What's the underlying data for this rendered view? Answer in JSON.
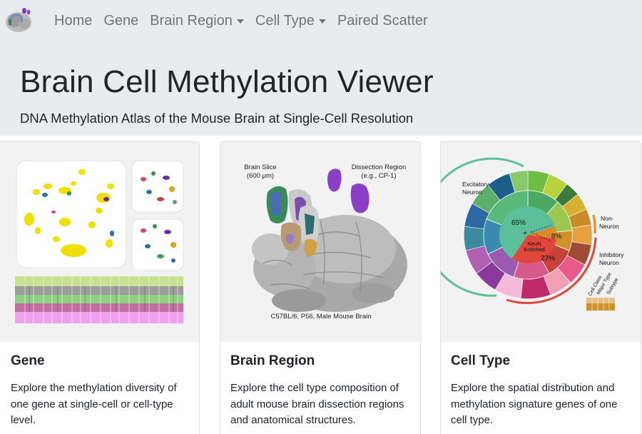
{
  "nav": {
    "items": [
      {
        "label": "Home",
        "dropdown": false
      },
      {
        "label": "Gene",
        "dropdown": false
      },
      {
        "label": "Brain Region",
        "dropdown": true
      },
      {
        "label": "Cell Type",
        "dropdown": true
      },
      {
        "label": "Paired Scatter",
        "dropdown": false
      }
    ]
  },
  "hero": {
    "title": "Brain Cell Methylation Viewer",
    "subtitle": "DNA Methylation Atlas of the Mouse Brain at Single-Cell Resolution"
  },
  "cards": [
    {
      "title": "Gene",
      "text": "Explore the methylation diversity of one gene at single-cell or cell-type level."
    },
    {
      "title": "Brain Region",
      "text": "Explore the cell type composition of adult mouse brain dissection regions and anatomical structures.",
      "figure": {
        "slice_label_1": "Brain Slice",
        "slice_label_2": "(600 μm)",
        "dissection_label_1": "Dissection Region",
        "dissection_label_2": "(e.g., CP-1)",
        "caption": "C57BL/6, P56, Male Mouse Brain"
      }
    },
    {
      "title": "Cell Type",
      "text": "Explore the spatial distribution and methylation signature genes of one cell type.",
      "figure": {
        "excitatory_1": "Excitatory",
        "excitatory_2": "Neuron",
        "non_neuron_1": "Non-",
        "non_neuron_2": "Neuron",
        "inhibitory_1": "Inhibitory",
        "inhibitory_2": "Neuron",
        "center_plus": "+",
        "center_1": "NeuN",
        "center_2": "Enriched",
        "pct_excitatory": "65%",
        "pct_non_neuron": "8%",
        "pct_inhibitory": "27%",
        "ring_1": "Cell Class",
        "ring_2": "Major Type",
        "ring_3": "Subtype"
      }
    }
  ],
  "colors": {
    "nav_bg": "#e9ecef",
    "nav_text": "#6c757d",
    "excitatory": "#5bbf9b",
    "inhibitory": "#e0463a",
    "non_neuron": "#d98a2b"
  }
}
